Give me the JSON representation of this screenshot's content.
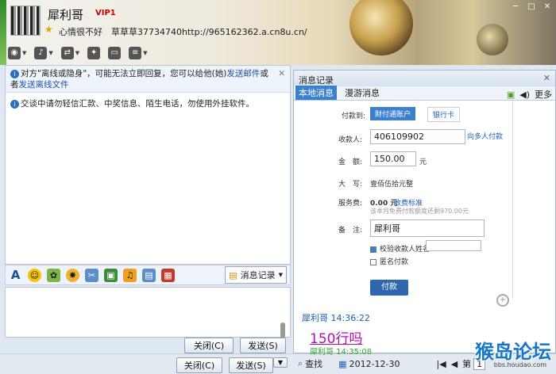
{
  "header": {
    "nickname": "犀利哥",
    "vip": "VIP1",
    "mood": "心情很不好",
    "signature": "草草草37734740http://965162362.a.cn8u.cn/",
    "window_controls": [
      "─",
      "□",
      "✕"
    ]
  },
  "toolbar": {
    "items": [
      "video-icon",
      "mic-icon",
      "transfer-icon",
      "app-icon",
      "screen-icon",
      "doc-icon"
    ]
  },
  "notice": {
    "text1": "对方\"离线或隐身\"，可能无法立即回复，您可以给他(她)",
    "link1": "发送邮件",
    "text2": "或者",
    "link2": "发送离线文件"
  },
  "warning": "交谈中请勿轻信汇款、中奖信息、陌生电话，勿使用外挂软件。",
  "format_bar": {
    "history_label": "消息记录"
  },
  "buttons": {
    "close1": "关闭(C)",
    "send1": "发送(S)",
    "close2": "关闭(C)",
    "send2": "发送(S)"
  },
  "history": {
    "title": "消息记录",
    "tabs": [
      "本地消息",
      "漫游消息"
    ],
    "more": "更多",
    "pay": {
      "payto_label": "付款到:",
      "method1": "财付通账户",
      "method2": "银行卡",
      "payee_label": "收款人:",
      "payee_value": "406109902",
      "multi": "向多人付款",
      "amount_label": "金　额:",
      "amount_value": "150.00",
      "unit": "元",
      "upper_label": "大　写:",
      "upper_value": "壹佰伍拾元整",
      "fee_label": "服务费:",
      "fee_value": "0.00 元",
      "fee_std": "收费标准",
      "fee_note": "该本月免费付款额度还剩970.00元",
      "memo_label": "备　注:",
      "memo_value": "犀利哥",
      "check1": "校验收款人姓名",
      "check2": "匿名付款",
      "pay_btn": "付款"
    },
    "msg_sender": "犀利哥",
    "msg_time": "14:36:22",
    "msg_text": "150行吗",
    "msg_partial": "犀利哥  14:35:08"
  },
  "bottom": {
    "search": "查找",
    "date": "2012-12-30",
    "page_label": "第",
    "page_num": "1"
  },
  "watermark": {
    "text": "猴岛论坛",
    "url": "bbs.houdao.com"
  }
}
